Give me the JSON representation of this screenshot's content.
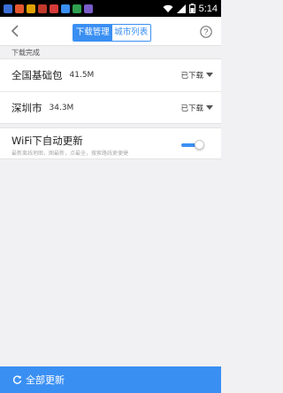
{
  "status_bar": {
    "app_icon_colors": [
      "#3b6fd6",
      "#e4572e",
      "#e0a100",
      "#c0392b",
      "#d63a3a",
      "#3a8ff3",
      "#2e9f4f",
      "#7a5cc8"
    ],
    "battery": "52%",
    "time": "5:14"
  },
  "header": {
    "tabs": [
      {
        "label": "下载管理",
        "active": true
      },
      {
        "label": "城市列表",
        "active": false
      }
    ]
  },
  "section_label": "下载完成",
  "downloads": [
    {
      "name": "全国基础包",
      "size": "41.5M",
      "status": "已下载"
    },
    {
      "name": "深圳市",
      "size": "34.3M",
      "status": "已下载"
    }
  ],
  "wifi_setting": {
    "title": "WiFi下自动更新",
    "description": "最新离线地图，图最新，点最全，搜索路线更便捷",
    "enabled": true
  },
  "bottom_bar": {
    "label": "全部更新"
  },
  "colors": {
    "accent": "#3a8ff3",
    "background": "#f1f1f3"
  }
}
